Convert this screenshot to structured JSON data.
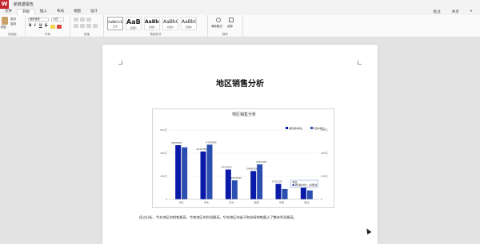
{
  "titlebar": {
    "logo": "W",
    "doc_title": "新数据报告"
  },
  "tabs": [
    {
      "label": "文件"
    },
    {
      "label": "开始"
    },
    {
      "label": "插入"
    },
    {
      "label": "布局"
    },
    {
      "label": "视图"
    },
    {
      "label": "设计"
    }
  ],
  "tab_right": {
    "comments": "批注",
    "share": "共享",
    "more": "▾"
  },
  "ribbon": {
    "clipboard": {
      "label": "剪贴板",
      "paste": "粘贴",
      "cut": "剪切",
      "copy": "复制"
    },
    "font": {
      "label": "字体",
      "font_name": "微软雅黑",
      "font_size": "小四",
      "bold": "B",
      "italic": "I",
      "underline": "U",
      "strike": "S"
    },
    "paragraph": {
      "label": "段落"
    },
    "styles": {
      "label": "快速样式",
      "items": [
        {
          "sample": "AaBbCcDc",
          "name": "正文"
        },
        {
          "sample": "AaBl",
          "name": "标题1"
        },
        {
          "sample": "AaBbC",
          "name": "标题2"
        },
        {
          "sample": "AaBbC",
          "name": "标题3"
        },
        {
          "sample": "AaBbC",
          "name": "标题4"
        }
      ]
    },
    "ops": {
      "label": "操作",
      "clear": "清除格式",
      "select": "选择"
    }
  },
  "document": {
    "title": "地区销售分析",
    "caption": "经过分析，华东地区的销售最高，华南地区的利润最高。华东地区的桌子和扶椅销售额占了整体利润最高。"
  },
  "chart_data": {
    "type": "bar",
    "title": "地区销售分析",
    "categories": [
      "华东",
      "华北",
      "东北",
      "西南",
      "华南",
      "西北"
    ],
    "series": [
      {
        "name": "销售额(单位)",
        "color": "#0a1aa8",
        "values": [
          4684506,
          4132761,
          2581567,
          2446739,
          1333125,
          1000000
        ]
      },
      {
        "name": "利润(单位)",
        "color": "#2b4fb0",
        "values": [
          4500000,
          4730885,
          1642592,
          3021053,
          900000,
          770000
        ]
      }
    ],
    "data_labels": [
      "4684506",
      "4132761",
      "4730885",
      "2581567",
      "1642592",
      "2446739",
      "3021053",
      "1333125"
    ],
    "ylim": [
      0,
      6000000
    ],
    "yticks_left": [
      "600万",
      "400万",
      "200万",
      "0"
    ],
    "yticks_right": [
      "600万",
      "400万",
      "200万",
      "0"
    ],
    "legend_position": "top-right",
    "tooltip": {
      "title": "西北",
      "line": "销售额(单位)：总销售额"
    }
  }
}
